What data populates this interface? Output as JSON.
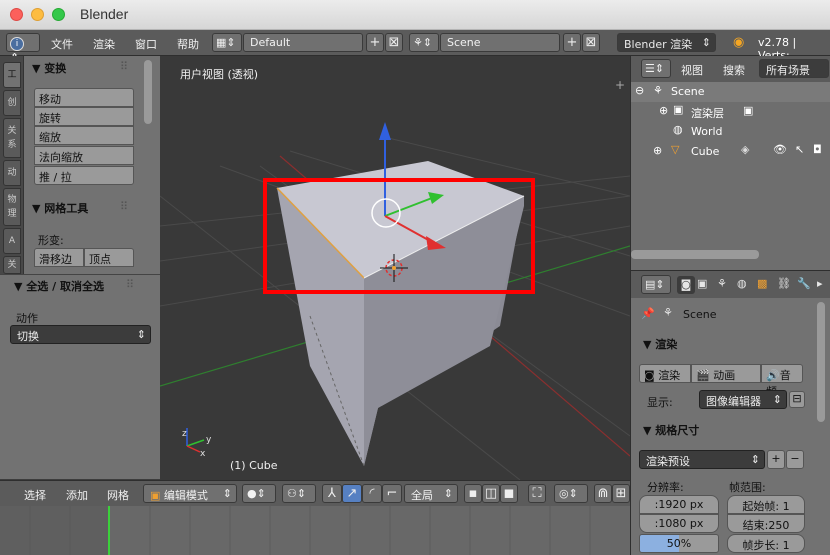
{
  "window": {
    "title": "Blender"
  },
  "topbar": {
    "menus": [
      "文件",
      "渲染",
      "窗口",
      "帮助"
    ],
    "layout_value": "Default",
    "scene_value": "Scene",
    "engine_value": "Blender 渲染",
    "version": "v2.78 | Verts:"
  },
  "toolshelf": {
    "tabs": [
      "工",
      "创",
      "关系",
      "动",
      "物理",
      "A",
      "关"
    ],
    "transform_header": "▼ 变换",
    "transform_buttons": [
      "移动",
      "旋转",
      "缩放",
      "法向缩放",
      "推 / 拉"
    ],
    "mesh_tools_header": "▼ 网格工具",
    "deform_label": "形变:",
    "slide_edge": "滑移边",
    "vertex": "顶点"
  },
  "operator_panel": {
    "header": "▼ 全选 / 取消全选",
    "action_label": "动作",
    "action_value": "切换"
  },
  "viewport": {
    "view_label": "用户视图 (透视)",
    "object_label": "(1) Cube",
    "colors": {
      "background": "#393939",
      "cube_top": "#c8c8d2",
      "cube_side_light": "#a2a2ac",
      "cube_side_dark": "#8d8d97",
      "selection_box": "#ff0000",
      "x_axis": "#e03030",
      "y_axis": "#30c030",
      "z_axis": "#3060e0"
    }
  },
  "outliner": {
    "header_view": "视图",
    "header_search": "搜索",
    "header_scope": "所有场景",
    "items": [
      "Scene",
      "渲染层",
      "World",
      "Cube"
    ]
  },
  "properties": {
    "scene_label": "Scene",
    "render_header": "▼ 渲染",
    "render_buttons": [
      "渲染",
      "动画",
      "音频"
    ],
    "display_label": "显示:",
    "display_value": "图像编辑器",
    "dimensions_header": "▼ 规格尺寸",
    "preset_value": "渲染预设",
    "resolution_label": "分辨率:",
    "res_x": ":1920 px",
    "res_y": ":1080 px",
    "res_percent": "50%",
    "frame_range_label": "帧范围:",
    "frame_start": "起始帧: 1",
    "frame_end": "结束:250",
    "frame_step": "帧步长: 1"
  },
  "bottombar": {
    "menus": [
      "选择",
      "添加",
      "网格"
    ],
    "mode_value": "编辑模式",
    "pivot_value": "全局"
  }
}
